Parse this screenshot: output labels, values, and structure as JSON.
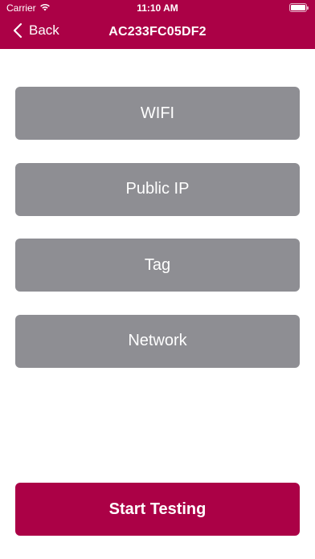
{
  "status_bar": {
    "carrier": "Carrier",
    "time": "11:10 AM",
    "wifi_icon": "wifi-icon",
    "battery_icon": "battery-icon",
    "battery_level": 1.0
  },
  "nav": {
    "back_label": "Back",
    "back_icon": "chevron-left-icon",
    "title": "AC233FC05DF2"
  },
  "options": [
    {
      "label": "WIFI"
    },
    {
      "label": "Public IP"
    },
    {
      "label": "Tag"
    },
    {
      "label": "Network"
    }
  ],
  "start_button": {
    "label": "Start Testing"
  },
  "colors": {
    "accent": "#ab0146",
    "option_background": "#8e8e93",
    "text_on_accent": "#ffffff"
  }
}
